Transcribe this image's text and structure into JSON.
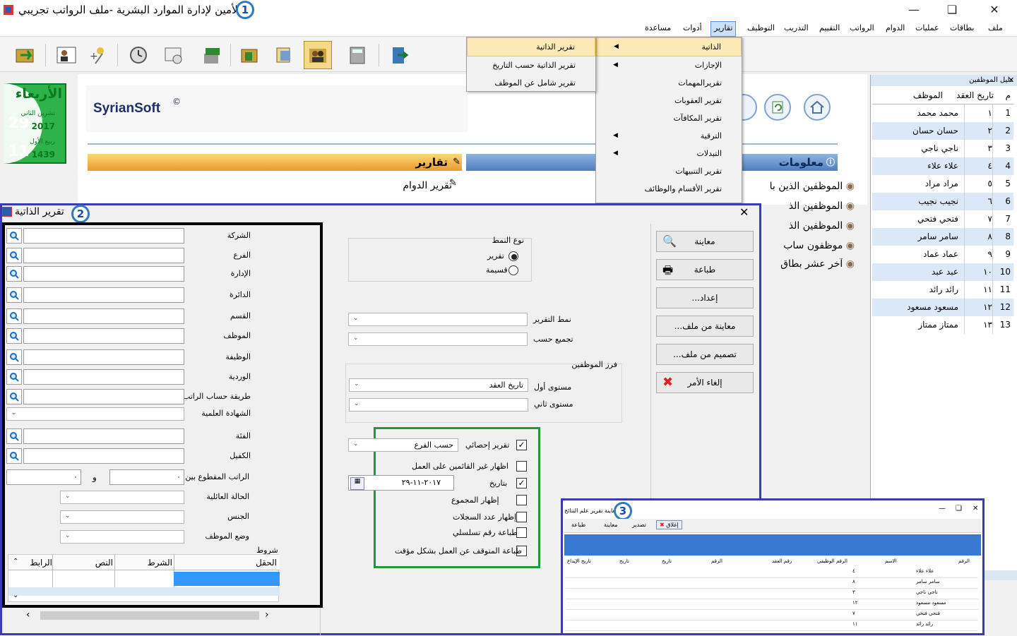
{
  "window": {
    "title": "الأمين لإدارة الموارد البشرية -ملف الرواتب تجريبي",
    "badge": "1"
  },
  "menubar": {
    "items": [
      "ملف",
      "بطاقات",
      "عمليات",
      "الدوام",
      "الرواتب",
      "التقييم",
      "التدريب",
      "التوظيف",
      "تقارير",
      "أدوات",
      "مساعدة"
    ]
  },
  "reports_menu": {
    "items": [
      "الذاتية",
      "الإجازات",
      "تقريرالمهمات",
      "تقرير العقوبات",
      "تقرير المكافآت",
      "الترقية",
      "التبدلات",
      "تقرير التنبيهات",
      "تقرير الأقسام والوظائف"
    ]
  },
  "submenu": {
    "items": [
      "تقرير الذاتية",
      "تقرير الذاتية حسب التاريخ",
      "تقرير شامل عن الموظف"
    ]
  },
  "date_panel": {
    "day_name": "الأربعاء",
    "greg_day": "29",
    "greg_month": "تشرين الثاني",
    "greg_year": "2017",
    "hijri_day": "11",
    "hijri_month": "ربيع الأول",
    "hijri_year": "1439"
  },
  "brand": "SyrianSoft",
  "brand_mark": "©",
  "reports_section": {
    "title": "تقارير",
    "link1": "تقرير الدوام"
  },
  "info_section": {
    "title": "معلومات",
    "items": [
      "الموظفين الذين با",
      "الموظفين الذ",
      "الموظفين الذ",
      "موظفون ساب",
      "آخر عشر بطاق"
    ]
  },
  "employee_panel": {
    "title": "دليل الموظفين",
    "col_num": "م",
    "col_date": "تاريخ العقد",
    "col_name": "الموظف",
    "rows": [
      {
        "n": "1",
        "d": "١",
        "name": "محمد محمد"
      },
      {
        "n": "2",
        "d": "٢",
        "name": "حسان حسان"
      },
      {
        "n": "3",
        "d": "٣",
        "name": "ناجي ناجي"
      },
      {
        "n": "4",
        "d": "٤",
        "name": "علاء علاء"
      },
      {
        "n": "5",
        "d": "٥",
        "name": "مراد مراد"
      },
      {
        "n": "6",
        "d": "٦",
        "name": "نجيب نجيب"
      },
      {
        "n": "7",
        "d": "٧",
        "name": "فتحي فتحي"
      },
      {
        "n": "8",
        "d": "٨",
        "name": "سامر سامر"
      },
      {
        "n": "9",
        "d": "٩",
        "name": "عماد عماد"
      },
      {
        "n": "10",
        "d": "١٠",
        "name": "عبد عبد"
      },
      {
        "n": "11",
        "d": "١١",
        "name": "رائد رائد"
      },
      {
        "n": "12",
        "d": "١٢",
        "name": "مسعود مسعود"
      },
      {
        "n": "13",
        "d": "١٣",
        "name": "ممتاز ممتاز"
      }
    ]
  },
  "dialog": {
    "title": "تقرير الذاتية",
    "badge": "2",
    "filter_labels": [
      "الشركة",
      "الفرع",
      "الإدارة",
      "الدائرة",
      "القسم",
      "الموظف",
      "الوظيفة",
      "الوردية",
      "طريقة حساب الراتب",
      "الشهادة العلمية",
      "الفئة",
      "الكفيل"
    ],
    "salary_between": "الراتب المقطوع بين",
    "salary_and": "و",
    "salary_from": "٠",
    "salary_to": "٠",
    "family_status": "الحالة العائلية",
    "gender": "الجنس",
    "emp_status": "وضع الموظف",
    "conditions": {
      "title": "شروط",
      "cols": [
        "الحقل",
        "الشرط",
        "النص",
        "الرابط"
      ]
    },
    "style_type": {
      "title": "نوع النمط",
      "opt1": "تقرير",
      "opt2": "قسيمة"
    },
    "report_style": "نمط التقرير",
    "group_by": "تجميع حسب",
    "sort": {
      "title": "فرز الموظفين",
      "level1": "مستوى أول",
      "level1_value": "تاريخ العقد",
      "level2": "مستوى ثاني"
    },
    "options": {
      "stat_report": "تقرير إحصائي",
      "stat_value": "حسب الفرع",
      "show_absent": "اظهار غير القائمين على العمل",
      "by_date": "بتاريخ",
      "date_value": "٢٠١٧-١١-٢٩",
      "show_total": "إظهار المجموع",
      "show_count": "إظهار عدد السجلات",
      "print_serial": "طباعة رقم تسلسلي",
      "print_suspended": "طباعة المتوقف عن العمل بشكل مؤقت"
    },
    "buttons": {
      "preview": "معاينة",
      "print": "طباعة",
      "setup": "إعداد...",
      "preview_file": "معاينة من ملف...",
      "design_file": "تصميم من ملف...",
      "cancel": "إلغاء الأمر"
    }
  },
  "preview_window": {
    "badge": "3",
    "title": "معاينة تقرير علم النتائج",
    "tb": [
      "إغلاق",
      "تصدير",
      "معاينة",
      "طباعة"
    ],
    "cols": [
      "الرقم",
      "الاسم",
      "الرقم الوظيفي",
      "رقم العقد",
      "الرقم",
      "تاريخ",
      "تاريخ",
      "تاريخ الإيداع"
    ],
    "rows": [
      {
        "name": "علاء علاء",
        "v": "٤"
      },
      {
        "name": "سامر سامر",
        "v": "٨"
      },
      {
        "name": "ناجي ناجي",
        "v": "٣"
      },
      {
        "name": "مسعود مسعود",
        "v": "١٢"
      },
      {
        "name": "فتحي فتحي",
        "v": "٧"
      },
      {
        "name": "رائد رائد",
        "v": "١١"
      }
    ]
  }
}
